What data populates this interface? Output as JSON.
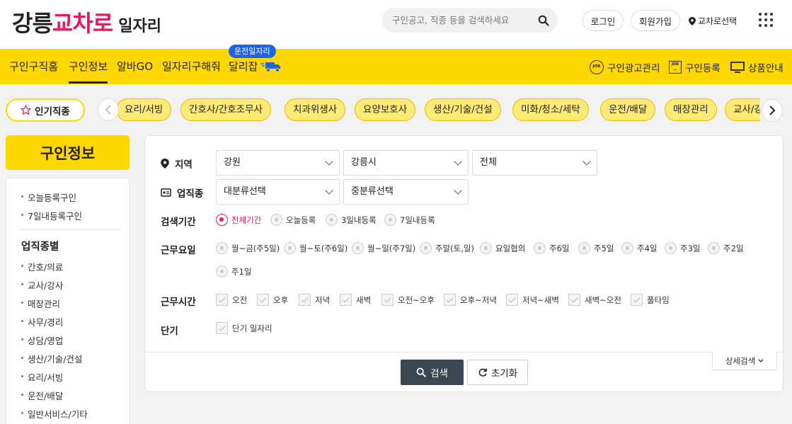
{
  "header": {
    "logo": {
      "part1": "강릉",
      "part2": "교차로",
      "part3": "일자리"
    },
    "search_placeholder": "구인공고, 직종 등을 검색하세요",
    "login": "로그인",
    "signup": "회원가입",
    "region_select": "교차로선택"
  },
  "nav": {
    "items": [
      "구인구직홈",
      "구인정보",
      "알바GO",
      "일자리구해줘",
      "달리잡"
    ],
    "active_index": 1,
    "badge": "운전일자리",
    "right": [
      "구인광고관리",
      "구인등록",
      "상품안내"
    ]
  },
  "categories": {
    "popular_label": "인기직종",
    "chips": [
      "요리/서빙",
      "간호사/간호조무사",
      "치과위생사",
      "요양보호사",
      "생산/기술/건설",
      "미화/청소/세탁",
      "운전/배달",
      "매장관리",
      "교사/강사"
    ]
  },
  "sidebar": {
    "title": "구인정보",
    "quick": [
      "오늘등록구인",
      "7일내등록구인"
    ],
    "section_title": "업직종별",
    "items": [
      "간호/의료",
      "교사/강사",
      "매장관리",
      "사무/경리",
      "상담/영업",
      "생산/기술/건설",
      "요리/서빙",
      "운전/배달",
      "일반서비스/기타"
    ]
  },
  "filters": {
    "region": {
      "label": "지역",
      "selects": [
        "강원",
        "강릉시",
        "전체"
      ]
    },
    "industry": {
      "label": "업직종",
      "selects": [
        "대분류선택",
        "중분류선택"
      ]
    },
    "period": {
      "label": "검색기간",
      "options": [
        "전체기간",
        "오늘등록",
        "3일내등록",
        "7일내등록"
      ],
      "selected": "전체기간"
    },
    "workdays": {
      "label": "근무요일",
      "options": [
        "월~금(주5일)",
        "월~토(주6일)",
        "월~일(주7일)",
        "주말(토,일)",
        "요일협의",
        "주6일",
        "주5일",
        "주4일",
        "주3일",
        "주2일",
        "주1일"
      ]
    },
    "worktime": {
      "label": "근무시간",
      "options": [
        "오전",
        "오후",
        "저녁",
        "새벽",
        "오전~오후",
        "오후~저녁",
        "저녁~새벽",
        "새벽~오전",
        "풀타임"
      ]
    },
    "shortterm": {
      "label": "단기",
      "options": [
        "단기 일자리"
      ]
    }
  },
  "buttons": {
    "search": "검색",
    "reset": "초기화",
    "detail": "상세검색"
  },
  "colors": {
    "brand_pink": "#e6195a",
    "brand_yellow": "#ffd800",
    "badge_blue": "#1d64e8",
    "search_button": "#3a4651"
  }
}
